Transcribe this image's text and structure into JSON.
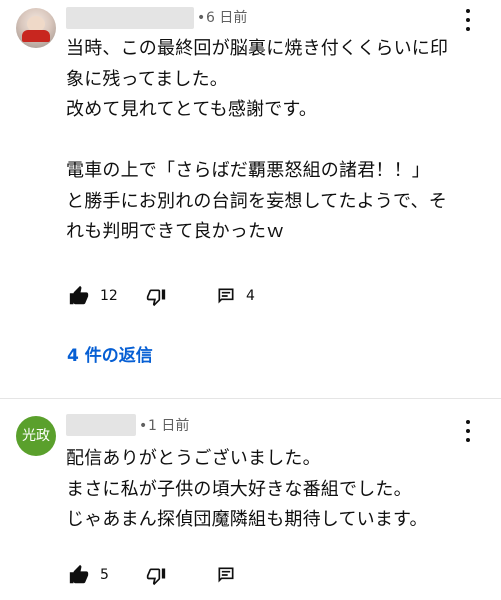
{
  "comments": [
    {
      "author_avatar": "photo-avatar",
      "dot": "•",
      "date": "6 日前",
      "text": "当時、この最終回が脳裏に焼き付くくらいに印\n象に残ってました。\n改めて見れてとても感謝です。\n\n電車の上で「さらばだ覇悪怒組の諸君！！」\nと勝手にお別れの台詞を妄想してたようで、そ\nれも判明できて良かったｗ",
      "likes": "12",
      "replies_count": "4",
      "replies_link": "4 件の返信"
    },
    {
      "author_avatar": "光政",
      "dot": "•",
      "date": "1 日前",
      "text": "配信ありがとうございました。\nまさに私が子供の頃大好きな番組でした。\nじゃあまん探偵団魔隣組も期待しています。",
      "likes": "5"
    }
  ],
  "icons": {
    "like": "thumb-up-icon",
    "dislike": "thumb-down-icon",
    "reply": "comment-icon",
    "menu": "more-vert-icon"
  },
  "colors": {
    "link": "#065fd4",
    "avatar_green": "#5aa02c",
    "meta": "#606060"
  }
}
